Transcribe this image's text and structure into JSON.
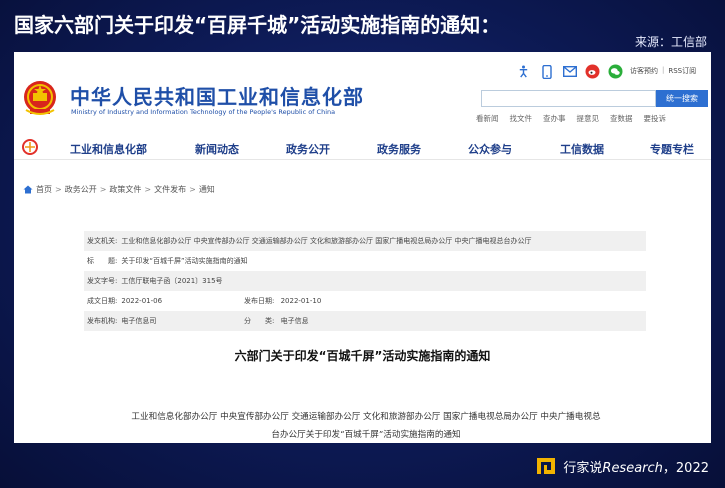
{
  "slide": {
    "title": "国家六部门关于印发“百屏千城”活动实施指南的通知：",
    "source": "来源：工信部"
  },
  "site": {
    "name_cn": "中华人民共和国工业和信息化部",
    "name_en": "Ministry of Industry and Information Technology of the People's Republic of China",
    "tool_links": [
      "访客预约",
      "RSS订阅"
    ],
    "search_placeholder": "",
    "search_button": "统一搜索",
    "quick_links": [
      "看新闻",
      "找文件",
      "查办事",
      "提意见",
      "查数据",
      "要投诉"
    ]
  },
  "nav": {
    "items": [
      "工业和信息化部",
      "新闻动态",
      "政务公开",
      "政务服务",
      "公众参与",
      "工信数据",
      "专题专栏"
    ]
  },
  "breadcrumb": [
    "首页",
    "政务公开",
    "政策文件",
    "文件发布",
    "通知"
  ],
  "doc_info": {
    "issuer_label": "发文机关:",
    "issuer_value": "工业和信息化部办公厅 中央宣传部办公厅 交通运输部办公厅 文化和旅游部办公厅 国家广播电视总局办公厅 中央广播电视总台办公厅",
    "title_label": "标　　题:",
    "title_value": "关于印发“百城千屏”活动实施指南的通知",
    "doc_no_label": "发文字号:",
    "doc_no_value": "工信厅联电子函〔2021〕315号",
    "created_label": "成文日期:",
    "created_value": "2022-01-06",
    "published_label": "发布日期:",
    "published_value": "2022-01-10",
    "org_label": "发布机构:",
    "org_value": "电子信息司",
    "category_label": "分　　类:",
    "category_value": "电子信息"
  },
  "document": {
    "title": "六部门关于印发“百城千屏”活动实施指南的通知",
    "issuers_line1": "工业和信息化部办公厅 中央宣传部办公厅 交通运输部办公厅 文化和旅游部办公厅 国家广播电视总局办公厅 中央广播电视总",
    "issuers_line2": "台办公厅关于印发“百城千屏”活动实施指南的通知"
  },
  "brand": {
    "cn": "行家说",
    "en": "Research",
    "year": "，2022"
  },
  "colors": {
    "ministry_blue": "#1f4fa8",
    "search_button": "#2d6fd1",
    "slide_bg": "#0d1a55"
  }
}
